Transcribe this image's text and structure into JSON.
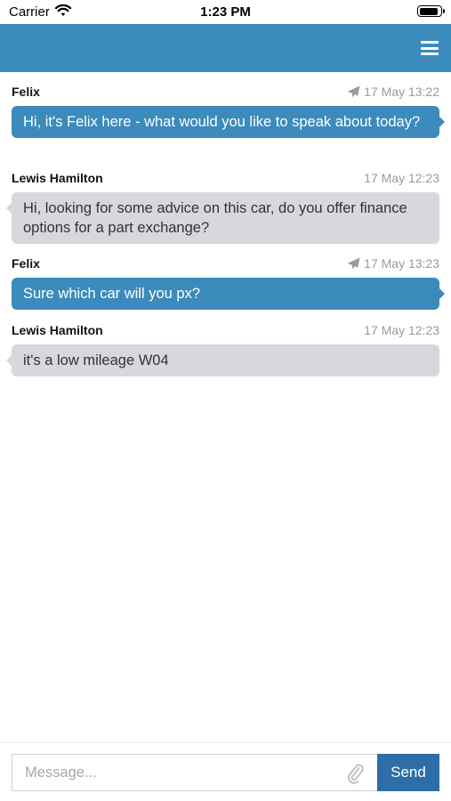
{
  "status_bar": {
    "carrier": "Carrier",
    "time": "1:23 PM",
    "battery_level": 0.9,
    "icons": [
      "wifi-icon",
      "battery-icon"
    ]
  },
  "header": {
    "background": "#3b8bbd",
    "menu_icon": "hamburger-menu-icon"
  },
  "messages": [
    {
      "sender": "Felix",
      "time": "17 May 13:22",
      "text": "Hi, it's Felix here - what would you like to speak about today?",
      "direction": "outgoing",
      "status_icon": "sent-paper-plane-icon"
    },
    {
      "sender": "Lewis Hamilton",
      "time": "17 May 12:23",
      "text": "Hi, looking for some advice on this car, do you offer finance options for a part exchange?",
      "direction": "incoming"
    },
    {
      "sender": "Felix",
      "time": "17 May 13:23",
      "text": "Sure which car will you px?",
      "direction": "outgoing",
      "status_icon": "sent-paper-plane-icon"
    },
    {
      "sender": "Lewis Hamilton",
      "time": "17 May 12:23",
      "text": "it's a low mileage W04",
      "direction": "incoming"
    }
  ],
  "composer": {
    "placeholder": "Message...",
    "value": "",
    "attach_icon": "paperclip-icon",
    "send_label": "Send"
  },
  "colors": {
    "accent": "#3b8bbd",
    "send_button": "#2d6ea8",
    "incoming_bubble": "#d6d8dd"
  }
}
